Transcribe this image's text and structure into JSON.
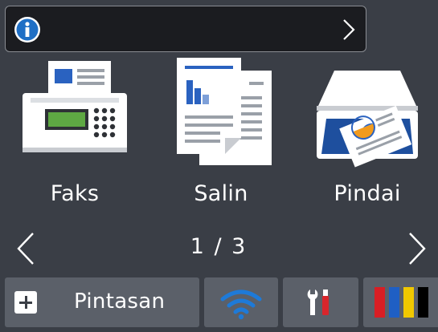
{
  "info_bar": {
    "icon": "info-icon",
    "chevron": "chevron-right-icon",
    "accent": "#1f6fc5"
  },
  "apps": [
    {
      "label": "Faks",
      "icon": "fax-machine-icon"
    },
    {
      "label": "Salin",
      "icon": "copy-documents-icon"
    },
    {
      "label": "Pindai",
      "icon": "scanner-icon"
    }
  ],
  "pager": {
    "page": "1 / 3",
    "prev_icon": "chevron-left-icon",
    "next_icon": "chevron-right-icon"
  },
  "bottom_bar": {
    "shortcut": {
      "label": "Pintasan",
      "icon": "plus-icon"
    },
    "wifi": {
      "icon": "wifi-icon",
      "color": "#1e7ad8"
    },
    "settings": {
      "icon": "settings-tools-icon",
      "accent": "#d8262c"
    },
    "ink": {
      "icon": "ink-levels-icon",
      "colors": [
        "#d81e24",
        "#1f5fc4",
        "#f0c800",
        "#000000"
      ]
    }
  }
}
